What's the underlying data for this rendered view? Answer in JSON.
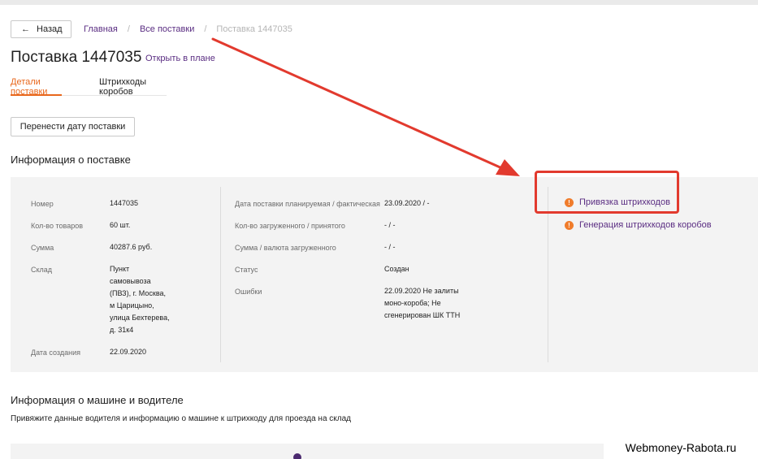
{
  "nav": {
    "back_label": "Назад",
    "breadcrumb": [
      "Главная",
      "Все поставки",
      "Поставка 1447035"
    ]
  },
  "header": {
    "title": "Поставка 1447035",
    "open_in_plan": "Открыть в плане"
  },
  "tabs": [
    {
      "label": "Детали поставки",
      "active": true
    },
    {
      "label": "Штрихкоды коробов",
      "active": false
    }
  ],
  "actions": {
    "move_date_label": "Перенести дату поставки"
  },
  "delivery_info": {
    "title": "Информация о поставке",
    "col1": [
      {
        "label": "Номер",
        "value": "1447035"
      },
      {
        "label": "Кол-во товаров",
        "value": "60 шт."
      },
      {
        "label": "Сумма",
        "value": "40287.6 руб."
      },
      {
        "label": "Склад",
        "value": [
          "Пункт",
          "самовывоза",
          "(ПВЗ), г. Москва,",
          "м Царицыно,",
          "улица Бехтерева,",
          "д. 31к4"
        ]
      },
      {
        "label": "Дата создания",
        "value": "22.09.2020"
      }
    ],
    "col2": [
      {
        "label": "Дата поставки планируемая / фактическая",
        "value": "23.09.2020 / -"
      },
      {
        "label": "Кол-во загруженного / принятого",
        "value": "- / -"
      },
      {
        "label": "Сумма / валюта загруженного",
        "value": "- / -"
      },
      {
        "label": "Статус",
        "value": "Создан"
      },
      {
        "label": "Ошибки",
        "value": [
          "22.09.2020 Не залиты",
          "моно-короба; Не",
          "сгенерирован ШК ТТН"
        ]
      }
    ],
    "links": [
      {
        "label": "Привязка штрихкодов",
        "icon": "warning-icon"
      },
      {
        "label": "Генерация штрихкодов коробов",
        "icon": "warning-icon"
      }
    ]
  },
  "driver_info": {
    "title": "Информация о машине и водителе",
    "description": "Привяжите данные водителя и информацию о машине к штрихкоду для проезда на склад"
  },
  "watermark": "Webmoney-Rabota.ru",
  "colors": {
    "accent_purple": "#5a2d82",
    "tab_active_orange": "#e8671c",
    "warning_orange": "#f07c2b",
    "annotation_red": "#e23a2e",
    "panel_bg": "#f3f3f3"
  }
}
